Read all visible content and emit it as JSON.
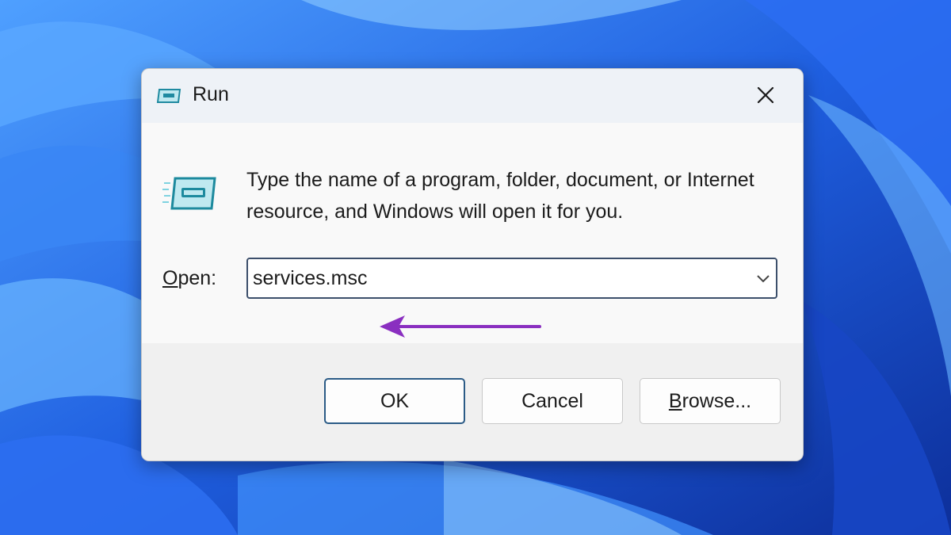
{
  "window": {
    "title": "Run",
    "close_icon": "close-icon",
    "app_icon": "run-app-icon"
  },
  "content": {
    "description": "Type the name of a program, folder, document, or Internet resource, and Windows will open it for you.",
    "open_label_mnemonic": "O",
    "open_label_rest": "pen:",
    "open_value": "services.msc",
    "annotation": "purple-arrow-pointing-at-input"
  },
  "buttons": {
    "ok": "OK",
    "cancel": "Cancel",
    "browse_mnemonic": "B",
    "browse_rest": "rowse..."
  },
  "colors": {
    "accent_border": "#2b5b86",
    "annotation_arrow": "#8a2fc0",
    "wallpaper": "#1d57d8"
  }
}
